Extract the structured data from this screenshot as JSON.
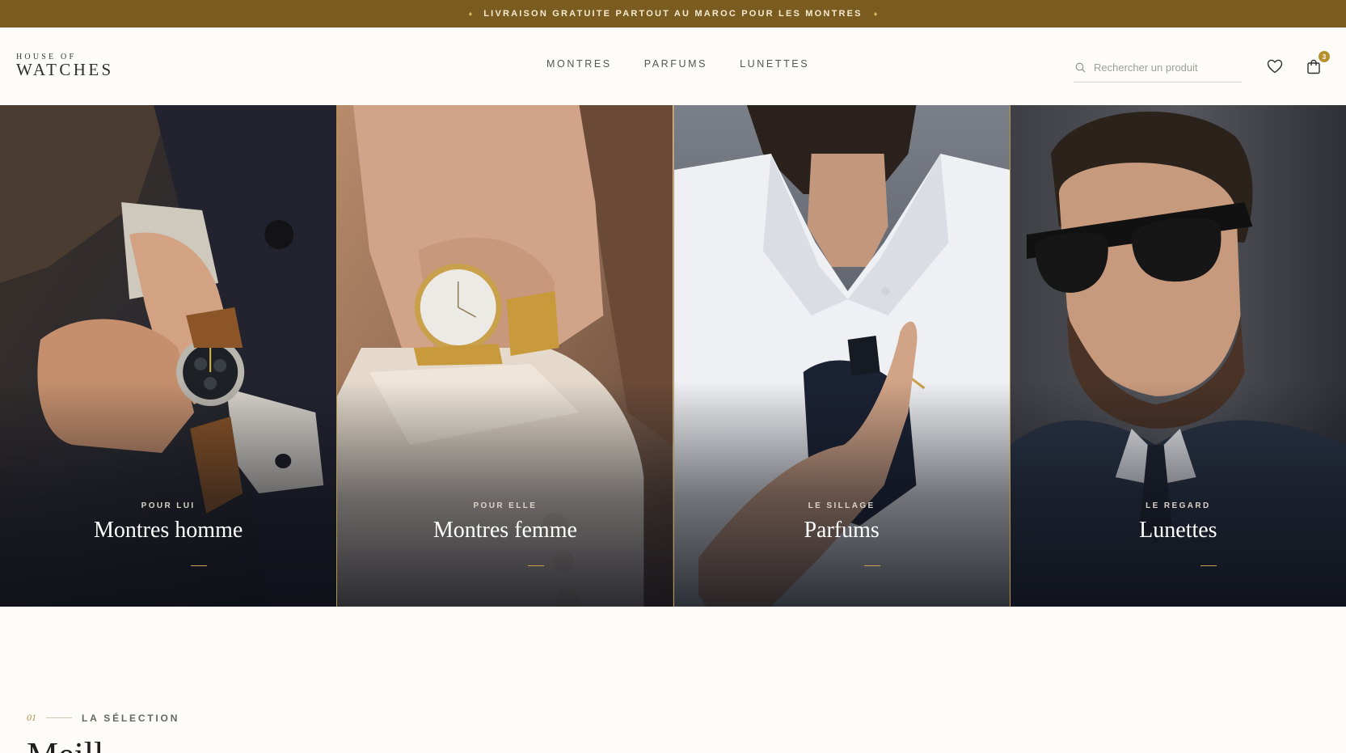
{
  "announcement": {
    "text": "LIVRAISON GRATUITE PARTOUT AU MAROC POUR LES MONTRES",
    "ornament": "♦"
  },
  "header": {
    "logo": {
      "line1": "HOUSE OF",
      "line2": "WATCHES"
    },
    "nav": [
      {
        "label": "MONTRES"
      },
      {
        "label": "PARFUMS"
      },
      {
        "label": "LUNETTES"
      }
    ],
    "search": {
      "placeholder": "Rechercher un produit",
      "icon": "search-icon"
    },
    "wishlist_icon": "heart-icon",
    "cart": {
      "icon": "shopping-bag-icon",
      "count": "3"
    }
  },
  "hero": {
    "panels": [
      {
        "eyebrow": "POUR LUI",
        "title": "Montres homme"
      },
      {
        "eyebrow": "POUR ELLE",
        "title": "Montres femme"
      },
      {
        "eyebrow": "LE SILLAGE",
        "title": "Parfums"
      },
      {
        "eyebrow": "LE REGARD",
        "title": "Lunettes"
      }
    ]
  },
  "selection": {
    "number": "01",
    "label": "LA SÉLECTION",
    "heading": "Meill"
  },
  "colors": {
    "announcement_bg": "#7a5c20",
    "accent_gold": "#b8912f",
    "page_bg": "#fdfcf8"
  }
}
